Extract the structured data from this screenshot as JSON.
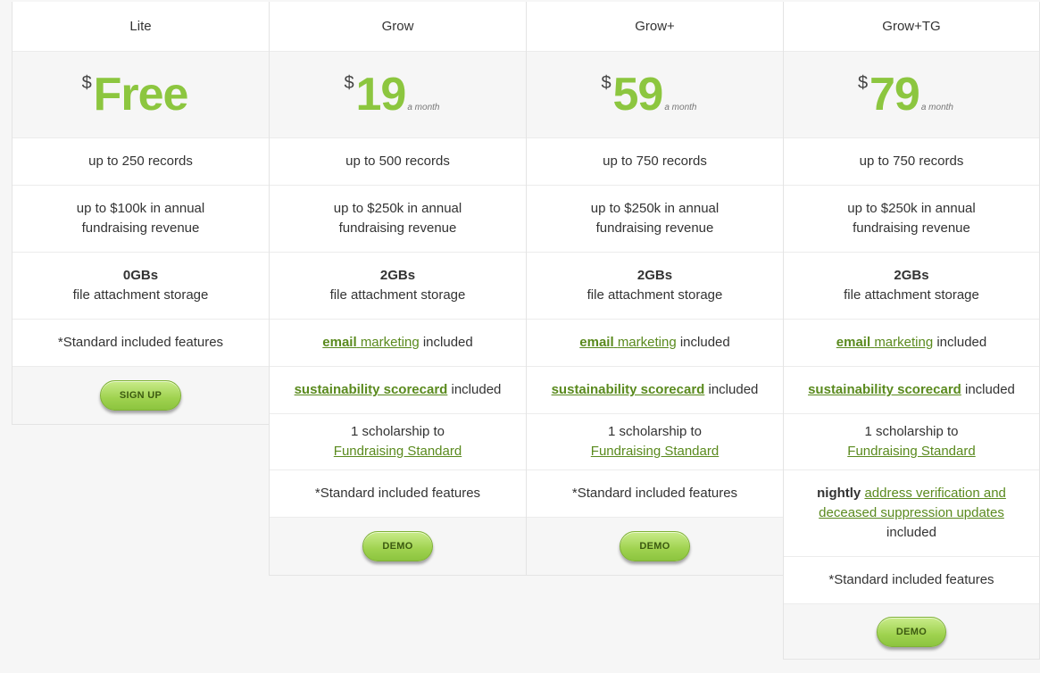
{
  "plans": [
    {
      "name": "Lite",
      "currency": "$",
      "price": "Free",
      "period": "",
      "records": "up to 250 records",
      "revenue_line1": "up to $100k in annual",
      "revenue_line2": "fundraising revenue",
      "storage_amount": "0GBs",
      "storage_label": "file attachment storage",
      "standard": "*Standard included features",
      "button": "SIGN UP"
    },
    {
      "name": "Grow",
      "currency": "$",
      "price": "19",
      "period": "a month",
      "records": "up to 500 records",
      "revenue_line1": "up to $250k in annual",
      "revenue_line2": "fundraising revenue",
      "storage_amount": "2GBs",
      "storage_label": "file attachment storage",
      "email_bold": "email",
      "email_link": "marketing",
      "email_suffix": " included",
      "scorecard_link": "sustainability scorecard",
      "scorecard_suffix": " included",
      "scholarship_text": "1 scholarship to",
      "scholarship_link": "Fundraising Standard",
      "standard": "*Standard included features",
      "button": "DEMO"
    },
    {
      "name": "Grow+",
      "currency": "$",
      "price": "59",
      "period": "a month",
      "records": "up to 750 records",
      "revenue_line1": "up to $250k in annual",
      "revenue_line2": "fundraising revenue",
      "storage_amount": "2GBs",
      "storage_label": "file attachment storage",
      "email_bold": "email",
      "email_link": "marketing",
      "email_suffix": " included",
      "scorecard_link": "sustainability scorecard",
      "scorecard_suffix": " included",
      "scholarship_text": "1 scholarship to",
      "scholarship_link": "Fundraising Standard",
      "standard": "*Standard included features",
      "button": "DEMO"
    },
    {
      "name": "Grow+TG",
      "currency": "$",
      "price": "79",
      "period": "a month",
      "records": "up to 750 records",
      "revenue_line1": "up to $250k in annual",
      "revenue_line2": "fundraising revenue",
      "storage_amount": "2GBs",
      "storage_label": "file attachment storage",
      "email_bold": "email",
      "email_link": "marketing",
      "email_suffix": " included",
      "scorecard_link": "sustainability scorecard",
      "scorecard_suffix": " included",
      "scholarship_text": "1 scholarship to",
      "scholarship_link": "Fundraising Standard",
      "nightly_bold": "nightly",
      "nightly_link_line1": "address verification and",
      "nightly_link_line2": "deceased suppression updates",
      "nightly_suffix": "included",
      "standard": "*Standard included features",
      "button": "DEMO"
    }
  ],
  "colors": {
    "accent": "#8cc63f",
    "link": "#5a8a1e",
    "button_text": "#3c5a10"
  }
}
